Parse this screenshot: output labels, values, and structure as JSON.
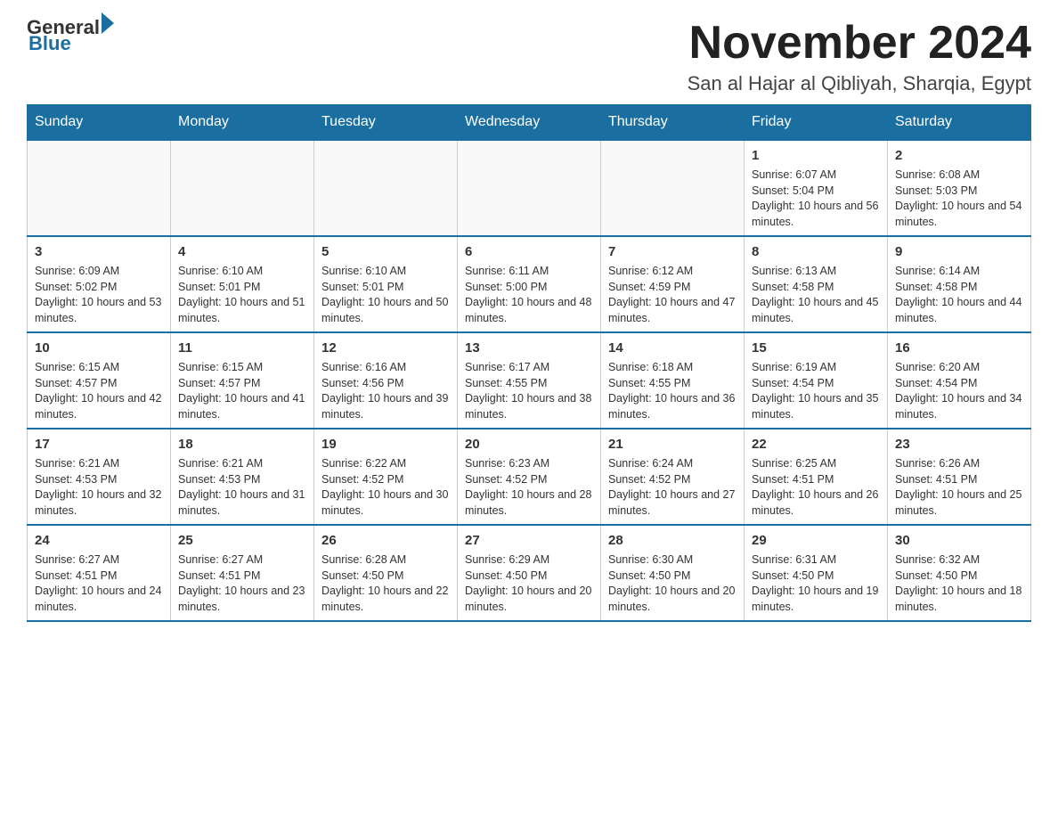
{
  "logo": {
    "general": "General",
    "blue": "Blue",
    "triangle_color": "#1a6fa0"
  },
  "header": {
    "title": "November 2024",
    "subtitle": "San al Hajar al Qibliyah, Sharqia, Egypt"
  },
  "weekdays": [
    "Sunday",
    "Monday",
    "Tuesday",
    "Wednesday",
    "Thursday",
    "Friday",
    "Saturday"
  ],
  "weeks": [
    {
      "days": [
        {
          "number": "",
          "info": ""
        },
        {
          "number": "",
          "info": ""
        },
        {
          "number": "",
          "info": ""
        },
        {
          "number": "",
          "info": ""
        },
        {
          "number": "",
          "info": ""
        },
        {
          "number": "1",
          "info": "Sunrise: 6:07 AM\nSunset: 5:04 PM\nDaylight: 10 hours and 56 minutes."
        },
        {
          "number": "2",
          "info": "Sunrise: 6:08 AM\nSunset: 5:03 PM\nDaylight: 10 hours and 54 minutes."
        }
      ]
    },
    {
      "days": [
        {
          "number": "3",
          "info": "Sunrise: 6:09 AM\nSunset: 5:02 PM\nDaylight: 10 hours and 53 minutes."
        },
        {
          "number": "4",
          "info": "Sunrise: 6:10 AM\nSunset: 5:01 PM\nDaylight: 10 hours and 51 minutes."
        },
        {
          "number": "5",
          "info": "Sunrise: 6:10 AM\nSunset: 5:01 PM\nDaylight: 10 hours and 50 minutes."
        },
        {
          "number": "6",
          "info": "Sunrise: 6:11 AM\nSunset: 5:00 PM\nDaylight: 10 hours and 48 minutes."
        },
        {
          "number": "7",
          "info": "Sunrise: 6:12 AM\nSunset: 4:59 PM\nDaylight: 10 hours and 47 minutes."
        },
        {
          "number": "8",
          "info": "Sunrise: 6:13 AM\nSunset: 4:58 PM\nDaylight: 10 hours and 45 minutes."
        },
        {
          "number": "9",
          "info": "Sunrise: 6:14 AM\nSunset: 4:58 PM\nDaylight: 10 hours and 44 minutes."
        }
      ]
    },
    {
      "days": [
        {
          "number": "10",
          "info": "Sunrise: 6:15 AM\nSunset: 4:57 PM\nDaylight: 10 hours and 42 minutes."
        },
        {
          "number": "11",
          "info": "Sunrise: 6:15 AM\nSunset: 4:57 PM\nDaylight: 10 hours and 41 minutes."
        },
        {
          "number": "12",
          "info": "Sunrise: 6:16 AM\nSunset: 4:56 PM\nDaylight: 10 hours and 39 minutes."
        },
        {
          "number": "13",
          "info": "Sunrise: 6:17 AM\nSunset: 4:55 PM\nDaylight: 10 hours and 38 minutes."
        },
        {
          "number": "14",
          "info": "Sunrise: 6:18 AM\nSunset: 4:55 PM\nDaylight: 10 hours and 36 minutes."
        },
        {
          "number": "15",
          "info": "Sunrise: 6:19 AM\nSunset: 4:54 PM\nDaylight: 10 hours and 35 minutes."
        },
        {
          "number": "16",
          "info": "Sunrise: 6:20 AM\nSunset: 4:54 PM\nDaylight: 10 hours and 34 minutes."
        }
      ]
    },
    {
      "days": [
        {
          "number": "17",
          "info": "Sunrise: 6:21 AM\nSunset: 4:53 PM\nDaylight: 10 hours and 32 minutes."
        },
        {
          "number": "18",
          "info": "Sunrise: 6:21 AM\nSunset: 4:53 PM\nDaylight: 10 hours and 31 minutes."
        },
        {
          "number": "19",
          "info": "Sunrise: 6:22 AM\nSunset: 4:52 PM\nDaylight: 10 hours and 30 minutes."
        },
        {
          "number": "20",
          "info": "Sunrise: 6:23 AM\nSunset: 4:52 PM\nDaylight: 10 hours and 28 minutes."
        },
        {
          "number": "21",
          "info": "Sunrise: 6:24 AM\nSunset: 4:52 PM\nDaylight: 10 hours and 27 minutes."
        },
        {
          "number": "22",
          "info": "Sunrise: 6:25 AM\nSunset: 4:51 PM\nDaylight: 10 hours and 26 minutes."
        },
        {
          "number": "23",
          "info": "Sunrise: 6:26 AM\nSunset: 4:51 PM\nDaylight: 10 hours and 25 minutes."
        }
      ]
    },
    {
      "days": [
        {
          "number": "24",
          "info": "Sunrise: 6:27 AM\nSunset: 4:51 PM\nDaylight: 10 hours and 24 minutes."
        },
        {
          "number": "25",
          "info": "Sunrise: 6:27 AM\nSunset: 4:51 PM\nDaylight: 10 hours and 23 minutes."
        },
        {
          "number": "26",
          "info": "Sunrise: 6:28 AM\nSunset: 4:50 PM\nDaylight: 10 hours and 22 minutes."
        },
        {
          "number": "27",
          "info": "Sunrise: 6:29 AM\nSunset: 4:50 PM\nDaylight: 10 hours and 20 minutes."
        },
        {
          "number": "28",
          "info": "Sunrise: 6:30 AM\nSunset: 4:50 PM\nDaylight: 10 hours and 20 minutes."
        },
        {
          "number": "29",
          "info": "Sunrise: 6:31 AM\nSunset: 4:50 PM\nDaylight: 10 hours and 19 minutes."
        },
        {
          "number": "30",
          "info": "Sunrise: 6:32 AM\nSunset: 4:50 PM\nDaylight: 10 hours and 18 minutes."
        }
      ]
    }
  ]
}
